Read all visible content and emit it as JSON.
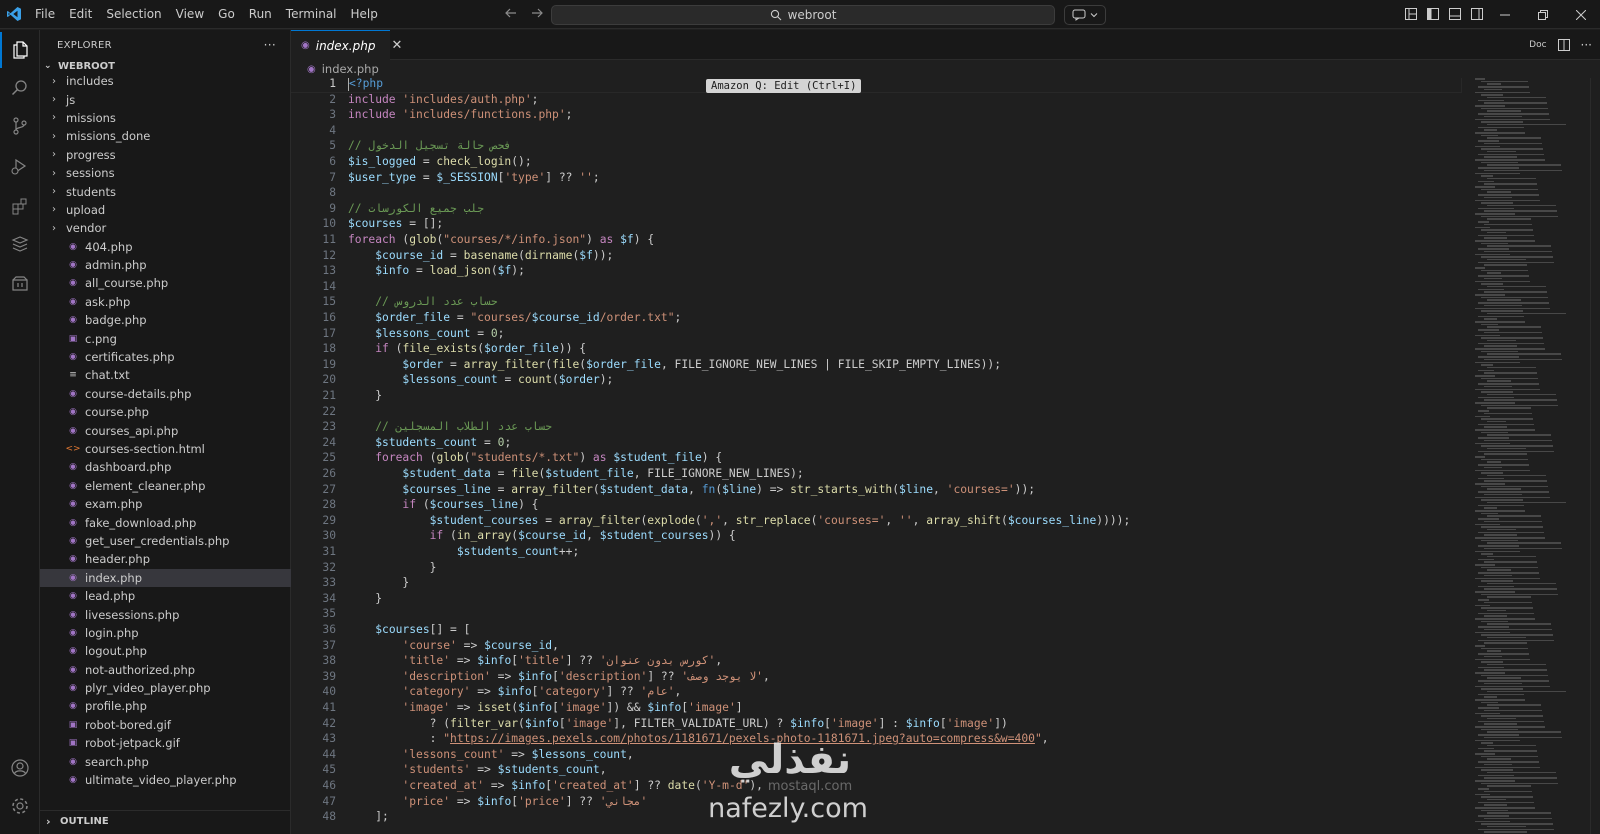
{
  "titlebar": {
    "menu": [
      "File",
      "Edit",
      "Selection",
      "View",
      "Go",
      "Run",
      "Terminal",
      "Help"
    ],
    "search_text": "webroot"
  },
  "sidebar": {
    "title": "EXPLORER",
    "more": "···",
    "folder": "WEBROOT",
    "items": [
      {
        "name": "includes",
        "type": "folder"
      },
      {
        "name": "js",
        "type": "folder"
      },
      {
        "name": "missions",
        "type": "folder"
      },
      {
        "name": "missions_done",
        "type": "folder"
      },
      {
        "name": "progress",
        "type": "folder"
      },
      {
        "name": "sessions",
        "type": "folder"
      },
      {
        "name": "students",
        "type": "folder"
      },
      {
        "name": "upload",
        "type": "folder"
      },
      {
        "name": "vendor",
        "type": "folder"
      },
      {
        "name": "404.php",
        "type": "php"
      },
      {
        "name": "admin.php",
        "type": "php"
      },
      {
        "name": "all_course.php",
        "type": "php"
      },
      {
        "name": "ask.php",
        "type": "php"
      },
      {
        "name": "badge.php",
        "type": "php"
      },
      {
        "name": "c.png",
        "type": "image"
      },
      {
        "name": "certificates.php",
        "type": "php"
      },
      {
        "name": "chat.txt",
        "type": "text"
      },
      {
        "name": "course-details.php",
        "type": "php"
      },
      {
        "name": "course.php",
        "type": "php"
      },
      {
        "name": "courses_api.php",
        "type": "php"
      },
      {
        "name": "courses-section.html",
        "type": "html"
      },
      {
        "name": "dashboard.php",
        "type": "php"
      },
      {
        "name": "element_cleaner.php",
        "type": "php"
      },
      {
        "name": "exam.php",
        "type": "php"
      },
      {
        "name": "fake_download.php",
        "type": "php"
      },
      {
        "name": "get_user_credentials.php",
        "type": "php"
      },
      {
        "name": "header.php",
        "type": "php"
      },
      {
        "name": "index.php",
        "type": "php",
        "selected": true
      },
      {
        "name": "lead.php",
        "type": "php"
      },
      {
        "name": "livesessions.php",
        "type": "php"
      },
      {
        "name": "login.php",
        "type": "php"
      },
      {
        "name": "logout.php",
        "type": "php"
      },
      {
        "name": "not-authorized.php",
        "type": "php"
      },
      {
        "name": "plyr_video_player.php",
        "type": "php"
      },
      {
        "name": "profile.php",
        "type": "php"
      },
      {
        "name": "robot-bored.gif",
        "type": "image"
      },
      {
        "name": "robot-jetpack.gif",
        "type": "image"
      },
      {
        "name": "search.php",
        "type": "php"
      },
      {
        "name": "ultimate_video_player.php",
        "type": "php"
      }
    ],
    "outline": "OUTLINE"
  },
  "editor": {
    "tab_label": "index.php",
    "breadcrumb": "index.php",
    "actions_label": "Doc",
    "hint": "Amazon Q: Edit (Ctrl+I)",
    "current_line": 1
  },
  "code_lines": [
    [
      [
        "tag",
        "<?php"
      ]
    ],
    [
      [
        "kw",
        "include "
      ],
      [
        "str",
        "'includes/auth.php'"
      ],
      [
        "p",
        ";"
      ]
    ],
    [
      [
        "kw",
        "include "
      ],
      [
        "str",
        "'includes/functions.php'"
      ],
      [
        "p",
        ";"
      ]
    ],
    [],
    [
      [
        "cm",
        "// فحص حالة تسجيل الدخول"
      ]
    ],
    [
      [
        "var",
        "$is_logged"
      ],
      [
        "p",
        " = "
      ],
      [
        "fn",
        "check_login"
      ],
      [
        "p",
        "();"
      ]
    ],
    [
      [
        "var",
        "$user_type"
      ],
      [
        "p",
        " = "
      ],
      [
        "var",
        "$_SESSION"
      ],
      [
        "p",
        "["
      ],
      [
        "str",
        "'type'"
      ],
      [
        "p",
        "] ?? "
      ],
      [
        "str",
        "''"
      ],
      [
        "p",
        ";"
      ]
    ],
    [],
    [
      [
        "cm",
        "// جلب جميع الكورسات"
      ]
    ],
    [
      [
        "var",
        "$courses"
      ],
      [
        "p",
        " = [];"
      ]
    ],
    [
      [
        "kw",
        "foreach "
      ],
      [
        "p",
        "("
      ],
      [
        "fn",
        "glob"
      ],
      [
        "p",
        "("
      ],
      [
        "str",
        "\"courses/*/info.json\""
      ],
      [
        "p",
        ") "
      ],
      [
        "kw",
        "as "
      ],
      [
        "var",
        "$f"
      ],
      [
        "p",
        ") {"
      ]
    ],
    [
      [
        "p",
        "    "
      ],
      [
        "var",
        "$course_id"
      ],
      [
        "p",
        " = "
      ],
      [
        "fn",
        "basename"
      ],
      [
        "p",
        "("
      ],
      [
        "fn",
        "dirname"
      ],
      [
        "p",
        "("
      ],
      [
        "var",
        "$f"
      ],
      [
        "p",
        "));"
      ]
    ],
    [
      [
        "p",
        "    "
      ],
      [
        "var",
        "$info"
      ],
      [
        "p",
        " = "
      ],
      [
        "fn",
        "load_json"
      ],
      [
        "p",
        "("
      ],
      [
        "var",
        "$f"
      ],
      [
        "p",
        ");"
      ]
    ],
    [],
    [
      [
        "p",
        "    "
      ],
      [
        "cm",
        "// حساب عدد الدروس"
      ]
    ],
    [
      [
        "p",
        "    "
      ],
      [
        "var",
        "$order_file"
      ],
      [
        "p",
        " = "
      ],
      [
        "str",
        "\"courses/"
      ],
      [
        "var",
        "$course_id"
      ],
      [
        "str",
        "/order.txt\""
      ],
      [
        "p",
        ";"
      ]
    ],
    [
      [
        "p",
        "    "
      ],
      [
        "var",
        "$lessons_count"
      ],
      [
        "p",
        " = "
      ],
      [
        "num",
        "0"
      ],
      [
        "p",
        ";"
      ]
    ],
    [
      [
        "p",
        "    "
      ],
      [
        "kw",
        "if "
      ],
      [
        "p",
        "("
      ],
      [
        "fn",
        "file_exists"
      ],
      [
        "p",
        "("
      ],
      [
        "var",
        "$order_file"
      ],
      [
        "p",
        ")) {"
      ]
    ],
    [
      [
        "p",
        "        "
      ],
      [
        "var",
        "$order"
      ],
      [
        "p",
        " = "
      ],
      [
        "fn",
        "array_filter"
      ],
      [
        "p",
        "("
      ],
      [
        "fn",
        "file"
      ],
      [
        "p",
        "("
      ],
      [
        "var",
        "$order_file"
      ],
      [
        "p",
        ", FILE_IGNORE_NEW_LINES | FILE_SKIP_EMPTY_LINES));"
      ]
    ],
    [
      [
        "p",
        "        "
      ],
      [
        "var",
        "$lessons_count"
      ],
      [
        "p",
        " = "
      ],
      [
        "fn",
        "count"
      ],
      [
        "p",
        "("
      ],
      [
        "var",
        "$order"
      ],
      [
        "p",
        ");"
      ]
    ],
    [
      [
        "p",
        "    }"
      ]
    ],
    [],
    [
      [
        "p",
        "    "
      ],
      [
        "cm",
        "// حساب عدد الطلاب المسجلين"
      ]
    ],
    [
      [
        "p",
        "    "
      ],
      [
        "var",
        "$students_count"
      ],
      [
        "p",
        " = "
      ],
      [
        "num",
        "0"
      ],
      [
        "p",
        ";"
      ]
    ],
    [
      [
        "p",
        "    "
      ],
      [
        "kw",
        "foreach "
      ],
      [
        "p",
        "("
      ],
      [
        "fn",
        "glob"
      ],
      [
        "p",
        "("
      ],
      [
        "str",
        "\"students/*.txt\""
      ],
      [
        "p",
        ") "
      ],
      [
        "kw",
        "as "
      ],
      [
        "var",
        "$student_file"
      ],
      [
        "p",
        ") {"
      ]
    ],
    [
      [
        "p",
        "        "
      ],
      [
        "var",
        "$student_data"
      ],
      [
        "p",
        " = "
      ],
      [
        "fn",
        "file"
      ],
      [
        "p",
        "("
      ],
      [
        "var",
        "$student_file"
      ],
      [
        "p",
        ", FILE_IGNORE_NEW_LINES);"
      ]
    ],
    [
      [
        "p",
        "        "
      ],
      [
        "var",
        "$courses_line"
      ],
      [
        "p",
        " = "
      ],
      [
        "fn",
        "array_filter"
      ],
      [
        "p",
        "("
      ],
      [
        "var",
        "$student_data"
      ],
      [
        "p",
        ", "
      ],
      [
        "tag",
        "fn"
      ],
      [
        "p",
        "("
      ],
      [
        "var",
        "$line"
      ],
      [
        "p",
        ") => "
      ],
      [
        "fn",
        "str_starts_with"
      ],
      [
        "p",
        "("
      ],
      [
        "var",
        "$line"
      ],
      [
        "p",
        ", "
      ],
      [
        "str",
        "'courses='"
      ],
      [
        "p",
        "));"
      ]
    ],
    [
      [
        "p",
        "        "
      ],
      [
        "kw",
        "if "
      ],
      [
        "p",
        "("
      ],
      [
        "var",
        "$courses_line"
      ],
      [
        "p",
        ") {"
      ]
    ],
    [
      [
        "p",
        "            "
      ],
      [
        "var",
        "$student_courses"
      ],
      [
        "p",
        " = "
      ],
      [
        "fn",
        "array_filter"
      ],
      [
        "p",
        "("
      ],
      [
        "fn",
        "explode"
      ],
      [
        "p",
        "("
      ],
      [
        "str",
        "','"
      ],
      [
        "p",
        ", "
      ],
      [
        "fn",
        "str_replace"
      ],
      [
        "p",
        "("
      ],
      [
        "str",
        "'courses='"
      ],
      [
        "p",
        ", "
      ],
      [
        "str",
        "''"
      ],
      [
        "p",
        ", "
      ],
      [
        "fn",
        "array_shift"
      ],
      [
        "p",
        "("
      ],
      [
        "var",
        "$courses_line"
      ],
      [
        "p",
        ")))); "
      ]
    ],
    [
      [
        "p",
        "            "
      ],
      [
        "kw",
        "if "
      ],
      [
        "p",
        "("
      ],
      [
        "fn",
        "in_array"
      ],
      [
        "p",
        "("
      ],
      [
        "var",
        "$course_id"
      ],
      [
        "p",
        ", "
      ],
      [
        "var",
        "$student_courses"
      ],
      [
        "p",
        ")) {"
      ]
    ],
    [
      [
        "p",
        "                "
      ],
      [
        "var",
        "$students_count"
      ],
      [
        "p",
        "++;"
      ]
    ],
    [
      [
        "p",
        "            }"
      ]
    ],
    [
      [
        "p",
        "        }"
      ]
    ],
    [
      [
        "p",
        "    }"
      ]
    ],
    [],
    [
      [
        "p",
        "    "
      ],
      [
        "var",
        "$courses"
      ],
      [
        "p",
        "[] = ["
      ]
    ],
    [
      [
        "p",
        "        "
      ],
      [
        "str",
        "'course'"
      ],
      [
        "p",
        " => "
      ],
      [
        "var",
        "$course_id"
      ],
      [
        "p",
        ","
      ]
    ],
    [
      [
        "p",
        "        "
      ],
      [
        "str",
        "'title'"
      ],
      [
        "p",
        " => "
      ],
      [
        "var",
        "$info"
      ],
      [
        "p",
        "["
      ],
      [
        "str",
        "'title'"
      ],
      [
        "p",
        "] ?? "
      ],
      [
        "str",
        "'كورس بدون عنوان'"
      ],
      [
        "p",
        ","
      ]
    ],
    [
      [
        "p",
        "        "
      ],
      [
        "str",
        "'description'"
      ],
      [
        "p",
        " => "
      ],
      [
        "var",
        "$info"
      ],
      [
        "p",
        "["
      ],
      [
        "str",
        "'description'"
      ],
      [
        "p",
        "] ?? "
      ],
      [
        "str",
        "'لا يوجد وصف'"
      ],
      [
        "p",
        ","
      ]
    ],
    [
      [
        "p",
        "        "
      ],
      [
        "str",
        "'category'"
      ],
      [
        "p",
        " => "
      ],
      [
        "var",
        "$info"
      ],
      [
        "p",
        "["
      ],
      [
        "str",
        "'category'"
      ],
      [
        "p",
        "] ?? "
      ],
      [
        "str",
        "'عام'"
      ],
      [
        "p",
        ","
      ]
    ],
    [
      [
        "p",
        "        "
      ],
      [
        "str",
        "'image'"
      ],
      [
        "p",
        " => "
      ],
      [
        "fn",
        "isset"
      ],
      [
        "p",
        "("
      ],
      [
        "var",
        "$info"
      ],
      [
        "p",
        "["
      ],
      [
        "str",
        "'image'"
      ],
      [
        "p",
        "]) && "
      ],
      [
        "var",
        "$info"
      ],
      [
        "p",
        "["
      ],
      [
        "str",
        "'image'"
      ],
      [
        "p",
        "]"
      ]
    ],
    [
      [
        "p",
        "            ? ("
      ],
      [
        "fn",
        "filter_var"
      ],
      [
        "p",
        "("
      ],
      [
        "var",
        "$info"
      ],
      [
        "p",
        "["
      ],
      [
        "str",
        "'image'"
      ],
      [
        "p",
        "], FILTER_VALIDATE_URL) ? "
      ],
      [
        "var",
        "$info"
      ],
      [
        "p",
        "["
      ],
      [
        "str",
        "'image'"
      ],
      [
        "p",
        "] : "
      ],
      [
        "var",
        "$info"
      ],
      [
        "p",
        "["
      ],
      [
        "str",
        "'image'"
      ],
      [
        "p",
        "])"
      ]
    ],
    [
      [
        "p",
        "            : "
      ],
      [
        "str",
        "\""
      ],
      [
        "url",
        "https://images.pexels.com/photos/1181671/pexels-photo-1181671.jpeg?auto=compress&w=400"
      ],
      [
        "str",
        "\""
      ],
      [
        "p",
        ","
      ]
    ],
    [
      [
        "p",
        "        "
      ],
      [
        "str",
        "'lessons_count'"
      ],
      [
        "p",
        " => "
      ],
      [
        "var",
        "$lessons_count"
      ],
      [
        "p",
        ","
      ]
    ],
    [
      [
        "p",
        "        "
      ],
      [
        "str",
        "'students'"
      ],
      [
        "p",
        " => "
      ],
      [
        "var",
        "$students_count"
      ],
      [
        "p",
        ","
      ]
    ],
    [
      [
        "p",
        "        "
      ],
      [
        "str",
        "'created_at'"
      ],
      [
        "p",
        " => "
      ],
      [
        "var",
        "$info"
      ],
      [
        "p",
        "["
      ],
      [
        "str",
        "'created_at'"
      ],
      [
        "p",
        "] ?? "
      ],
      [
        "fn",
        "date"
      ],
      [
        "p",
        "("
      ],
      [
        "str",
        "'Y-m-d'"
      ],
      [
        "p",
        "),"
      ]
    ],
    [
      [
        "p",
        "        "
      ],
      [
        "str",
        "'price'"
      ],
      [
        "p",
        " => "
      ],
      [
        "var",
        "$info"
      ],
      [
        "p",
        "["
      ],
      [
        "str",
        "'price'"
      ],
      [
        "p",
        "] ?? "
      ],
      [
        "str",
        "'مجاني'"
      ]
    ],
    [
      [
        "p",
        "    ];"
      ]
    ]
  ],
  "watermark": {
    "text_top": "نفذلي",
    "text_mid": "mostaql.com",
    "text_bottom": "nafezly.com"
  },
  "colors": {
    "accent": "#0078d4",
    "php_icon": "#a074c4",
    "html_icon": "#e37933",
    "image_icon": "#a074c4"
  }
}
